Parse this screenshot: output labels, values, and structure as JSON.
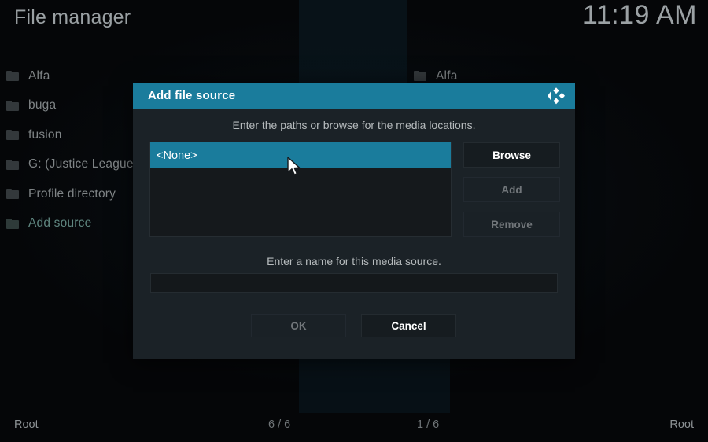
{
  "window": {
    "title": "File manager",
    "clock": "11:19 AM"
  },
  "colors": {
    "accent_teal": "#1a7c9c",
    "dialog_bg": "#1b2227",
    "screen_bg": "#050608",
    "text_primary": "#cfd4d6",
    "text_dim": "#71767a",
    "sidebar_accent": "#5f8680"
  },
  "left_pane": {
    "items": [
      {
        "label": "Alfa",
        "icon": "folder-icon",
        "accent": false
      },
      {
        "label": "buga",
        "icon": "folder-icon",
        "accent": false
      },
      {
        "label": "fusion",
        "icon": "folder-icon",
        "accent": false
      },
      {
        "label": "G: (Justice League)",
        "icon": "folder-icon",
        "accent": false
      },
      {
        "label": "Profile directory",
        "icon": "folder-icon",
        "accent": false
      },
      {
        "label": "Add source",
        "icon": "folder-icon",
        "accent": true
      }
    ]
  },
  "right_pane": {
    "items": [
      {
        "label": "Alfa",
        "icon": "folder-icon",
        "accent": false
      }
    ]
  },
  "statusbar": {
    "left_path": "Root",
    "left_count": "6 / 6",
    "right_count": "1 / 6",
    "right_path": "Root"
  },
  "dialog": {
    "title": "Add file source",
    "logo_icon": "kodi-logo-icon",
    "subtitle": "Enter the paths or browse for the media locations.",
    "paths": [
      {
        "label": "<None>",
        "selected": true
      }
    ],
    "side_buttons": [
      {
        "label": "Browse",
        "disabled": false
      },
      {
        "label": "Add",
        "disabled": true
      },
      {
        "label": "Remove",
        "disabled": true
      }
    ],
    "name_label": "Enter a name for this media source.",
    "name_input": {
      "value": "",
      "placeholder": ""
    },
    "footer_buttons": [
      {
        "label": "OK",
        "disabled": true
      },
      {
        "label": "Cancel",
        "disabled": false
      }
    ]
  }
}
